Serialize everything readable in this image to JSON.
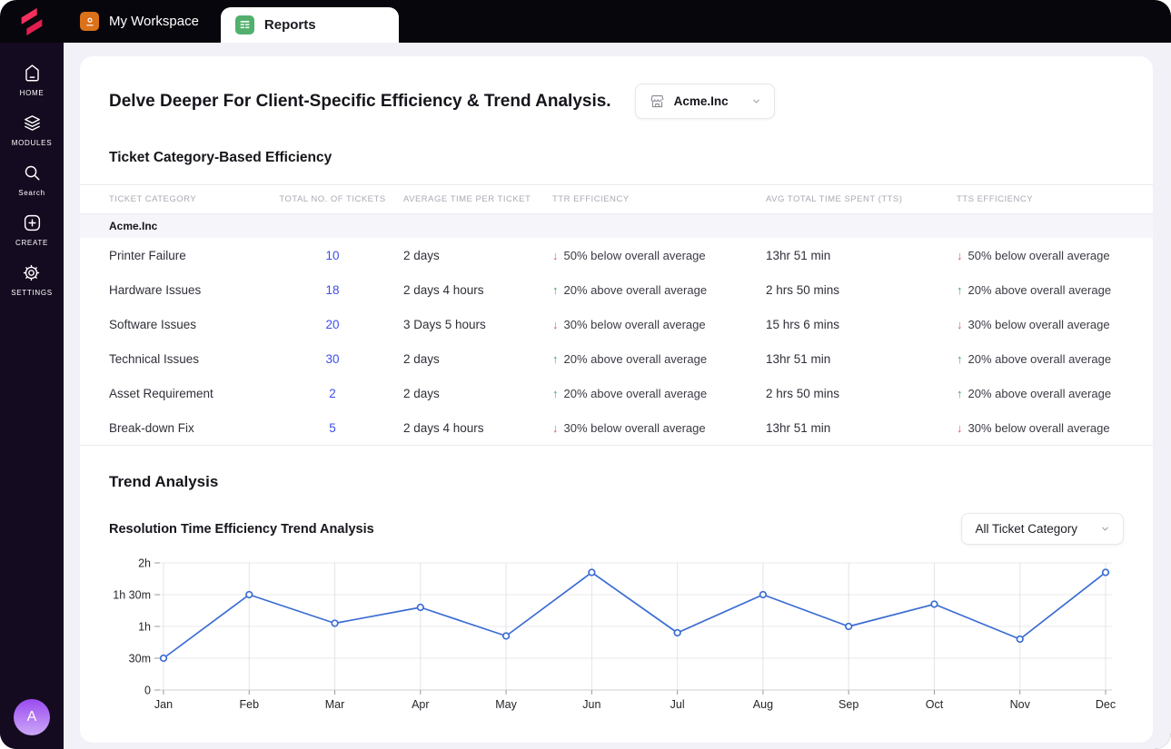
{
  "brand": {
    "logo_color": "#F23557"
  },
  "topbar": {
    "tabs": [
      {
        "icon": "user-icon",
        "label": "My Workspace",
        "active": false
      },
      {
        "icon": "report-icon",
        "label": "Reports",
        "active": true
      }
    ]
  },
  "sidebar": {
    "items": [
      {
        "icon": "home-icon",
        "label": "HOME"
      },
      {
        "icon": "modules-icon",
        "label": "MODULES"
      },
      {
        "icon": "search-icon",
        "label": "Search"
      },
      {
        "icon": "create-icon",
        "label": "CREATE"
      },
      {
        "icon": "settings-icon",
        "label": "SETTINGS"
      }
    ],
    "avatar_letter": "A"
  },
  "header": {
    "title": "Delve Deeper For Client-Specific Efficiency & Trend Analysis.",
    "client_dropdown": {
      "icon": "storefront-icon",
      "value": "Acme.Inc"
    }
  },
  "efficiency_table": {
    "section_title": "Ticket Category-Based Efficiency",
    "columns": [
      "TICKET CATEGORY",
      "TOTAL NO. OF TICKETS",
      "AVERAGE TIME PER TICKET",
      "TTR EFFICIENCY",
      "AVG TOTAL TIME SPENT (TTS)",
      "TTS EFFICIENCY"
    ],
    "group_label": "Acme.Inc",
    "rows": [
      {
        "category": "Printer Failure",
        "total_tickets": "10",
        "avg_time_per_ticket": "2 days",
        "ttr_efficiency": {
          "direction": "down",
          "text": "50% below overall average"
        },
        "avg_total_time_spent": "13hr 51 min",
        "tts_efficiency": {
          "direction": "down",
          "text": "50% below overall average"
        }
      },
      {
        "category": "Hardware Issues",
        "total_tickets": "18",
        "avg_time_per_ticket": "2 days 4 hours",
        "ttr_efficiency": {
          "direction": "up",
          "text": "20% above overall average"
        },
        "avg_total_time_spent": "2 hrs 50 mins",
        "tts_efficiency": {
          "direction": "up",
          "text": "20% above overall average"
        }
      },
      {
        "category": "Software Issues",
        "total_tickets": "20",
        "avg_time_per_ticket": "3 Days 5 hours",
        "ttr_efficiency": {
          "direction": "down",
          "text": "30% below overall average"
        },
        "avg_total_time_spent": "15 hrs 6 mins",
        "tts_efficiency": {
          "direction": "down",
          "text": "30% below overall average"
        }
      },
      {
        "category": "Technical Issues",
        "total_tickets": "30",
        "avg_time_per_ticket": "2 days",
        "ttr_efficiency": {
          "direction": "up",
          "text": "20% above overall average"
        },
        "avg_total_time_spent": "13hr 51 min",
        "tts_efficiency": {
          "direction": "up",
          "text": "20% above overall average"
        }
      },
      {
        "category": "Asset Requirement",
        "total_tickets": "2",
        "avg_time_per_ticket": "2 days",
        "ttr_efficiency": {
          "direction": "up",
          "text": "20% above overall average"
        },
        "avg_total_time_spent": "2 hrs 50 mins",
        "tts_efficiency": {
          "direction": "up",
          "text": "20% above overall average"
        }
      },
      {
        "category": "Break-down Fix",
        "total_tickets": "5",
        "avg_time_per_ticket": "2 days 4 hours",
        "ttr_efficiency": {
          "direction": "down",
          "text": "30% below overall average"
        },
        "avg_total_time_spent": "13hr 51 min",
        "tts_efficiency": {
          "direction": "down",
          "text": "30% below overall average"
        }
      }
    ]
  },
  "trend_section": {
    "title": "Trend Analysis",
    "chart_title": "Resolution Time Efficiency Trend Analysis",
    "category_dropdown": {
      "value": "All Ticket Category"
    }
  },
  "chart_data": {
    "type": "line",
    "title": "Resolution Time Efficiency Trend Analysis",
    "x": [
      "Jan",
      "Feb",
      "Mar",
      "Apr",
      "May",
      "Jun",
      "Jul",
      "Aug",
      "Sep",
      "Oct",
      "Nov",
      "Dec"
    ],
    "series": [
      {
        "name": "Resolution Time",
        "values_hours": [
          0.5,
          1.5,
          1.05,
          1.3,
          0.85,
          1.85,
          0.9,
          1.5,
          1.0,
          1.35,
          0.8,
          1.85
        ]
      }
    ],
    "y_ticks": [
      {
        "value": 0,
        "label": "0"
      },
      {
        "value": 0.5,
        "label": "30m"
      },
      {
        "value": 1,
        "label": "1h"
      },
      {
        "value": 1.5,
        "label": "1h 30m"
      },
      {
        "value": 2,
        "label": "2h"
      }
    ],
    "ylim": [
      0,
      2
    ],
    "xlabel": "",
    "ylabel": "",
    "grid": true,
    "legend": "none",
    "line_color": "#3A6CD3",
    "marker": "open-circle"
  },
  "icons": {
    "arrow_up": "↑",
    "arrow_down": "↓"
  },
  "status_colors": {
    "positive": "#43A45B",
    "negative": "#E15B5B",
    "count_link": "#3D4EEA"
  }
}
